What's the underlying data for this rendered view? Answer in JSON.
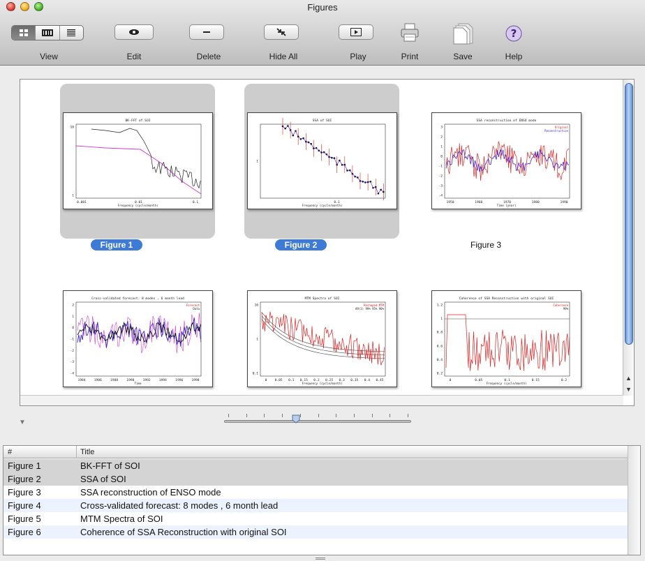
{
  "window": {
    "title": "Figures"
  },
  "toolbar": {
    "view_label": "View",
    "edit_label": "Edit",
    "delete_label": "Delete",
    "hide_all_label": "Hide All",
    "play_label": "Play",
    "print_label": "Print",
    "save_label": "Save",
    "help_label": "Help",
    "view_modes": [
      "grid-view-icon",
      "filmstrip-view-icon",
      "list-view-icon"
    ],
    "active_view": "grid-view-icon"
  },
  "figures": [
    {
      "label": "Figure 1",
      "title": "BK-FFT of SOI",
      "selected": true,
      "xlabel": "Frequency (cycle/month)",
      "yticks": [
        "10",
        "1"
      ],
      "xticks": [
        "0.001",
        "0.01",
        "0.1"
      ]
    },
    {
      "label": "Figure 2",
      "title": "SSA of SOI",
      "selected": true,
      "xlabel": "Frequency (cycle/month)",
      "yticks": [
        "1"
      ],
      "xticks": [
        "0.1"
      ]
    },
    {
      "label": "Figure 3",
      "title": "SSA reconstruction of ENSO mode",
      "selected": false,
      "xlabel": "Time (year)",
      "legend": [
        "Original",
        "Reconstruction"
      ],
      "yticks": [
        "3",
        "2",
        "1",
        "0",
        "-1",
        "-2",
        "-3",
        "-4"
      ],
      "xticks": [
        "1950",
        "1960",
        "1970",
        "1980",
        "1990"
      ]
    },
    {
      "label": "Figure 4",
      "title": "Cross-validated forecast: 8 modes , 6 month lead",
      "selected": false,
      "xlabel": "Time",
      "legend": [
        "Forecast",
        "Data"
      ],
      "yticks": [
        "2",
        "1",
        "0",
        "-1",
        "-2",
        "-3",
        "-4"
      ],
      "xticks": [
        "1984",
        "1986",
        "1988",
        "1990",
        "1992",
        "1994",
        "1996",
        "1998"
      ]
    },
    {
      "label": "Figure 5",
      "title": "MTM Spectra of SOI",
      "selected": false,
      "xlabel": "Frequency (cycle/month)",
      "legend": [
        "Reshaped MTM",
        "AR(1) 99% 95% 90%"
      ],
      "yticks": [
        "10",
        "1",
        "0.1"
      ],
      "xticks": [
        "0",
        "0.05",
        "0.1",
        "0.15",
        "0.2",
        "0.25",
        "0.3",
        "0.35",
        "0.4",
        "0.45"
      ]
    },
    {
      "label": "Figure 6",
      "title": "Coherence of SSA Reconstruction with original SOI",
      "selected": false,
      "xlabel": "Frequency (cycle/month)",
      "legend": [
        "Coherence",
        "99%"
      ],
      "yticks": [
        "1.2",
        "1",
        "0.8",
        "0.6",
        "0.4",
        "0.2"
      ],
      "xticks": [
        "0",
        "0.05",
        "0.1",
        "0.15",
        "0.2"
      ]
    }
  ],
  "table": {
    "columns": [
      "#",
      "Title"
    ],
    "rows": [
      {
        "num": "Figure 1",
        "title": "BK-FFT of SOI"
      },
      {
        "num": "Figure 2",
        "title": "SSA of SOI"
      },
      {
        "num": "Figure 3",
        "title": "SSA reconstruction of ENSO mode"
      },
      {
        "num": "Figure 4",
        "title": "Cross-validated forecast: 8 modes , 6 month lead"
      },
      {
        "num": "Figure 5",
        "title": "MTM Spectra of SOI"
      },
      {
        "num": "Figure 6",
        "title": "Coherence of SSA Reconstruction with original SOI"
      }
    ]
  },
  "slider": {
    "position": 0.38
  },
  "colors": {
    "selection_blue": "#3d7bd6",
    "series_red": "#e02020",
    "series_blue": "#3a22d8",
    "series_magenta": "#d63ad6"
  }
}
